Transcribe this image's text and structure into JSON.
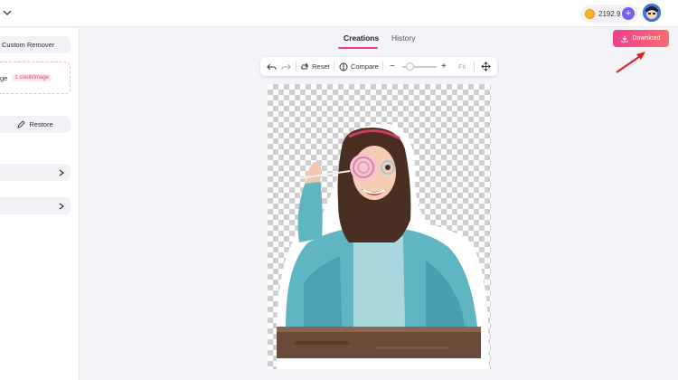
{
  "header": {
    "credits": "2192.9",
    "plus_symbol": "+"
  },
  "sidebar": {
    "custom_remover_label": "Custom Remover",
    "upload_label": "ge",
    "credit_badge": "1 credit/image",
    "restore_label": "Restore"
  },
  "tabs": [
    {
      "label": "Creations",
      "active": true
    },
    {
      "label": "History",
      "active": false
    }
  ],
  "download_label": "Download",
  "toolbar": {
    "reset_label": "Reset",
    "compare_label": "Compare",
    "zoom_minus": "−",
    "zoom_plus": "+",
    "fit_label": "Fit"
  },
  "icons": [
    "chevron-down-icon",
    "coin-icon",
    "download-icon",
    "undo-icon",
    "redo-icon",
    "reset-icon",
    "compare-icon",
    "move-icon",
    "pencil-icon",
    "chevron-right-icon"
  ],
  "colors": {
    "accent_pink": "#e7417e",
    "download_gradient_start": "#f03f8e",
    "download_gradient_end": "#fb6c6c",
    "plus_purple": "#7d5cf0",
    "annotation_arrow": "#e02020"
  }
}
